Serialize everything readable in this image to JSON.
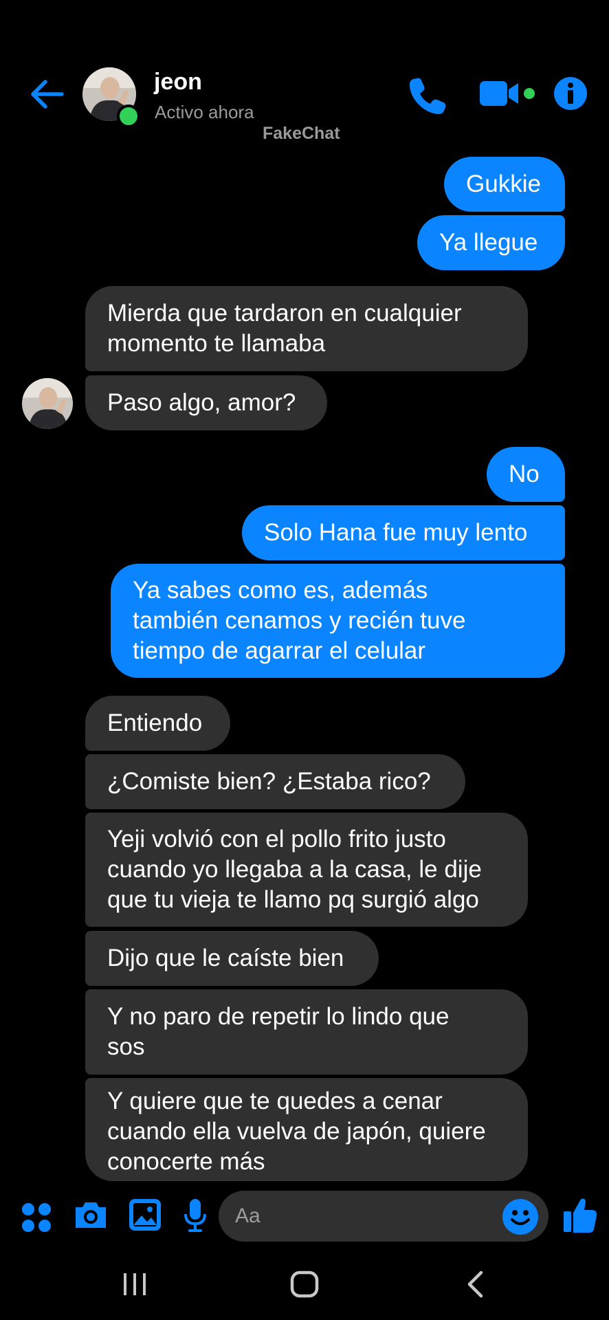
{
  "header": {
    "contact_name": "jeon",
    "status": "Activo ahora",
    "watermark": "FakeChat"
  },
  "messages": [
    {
      "from": "me",
      "text": "Gukkie"
    },
    {
      "from": "me",
      "text": "Ya llegue"
    },
    {
      "from": "them",
      "lines": [
        "Mierda que tardaron en cualquier",
        "momento te llamaba"
      ]
    },
    {
      "from": "them",
      "text": "Paso algo, amor?"
    },
    {
      "from": "me",
      "text": "No"
    },
    {
      "from": "me",
      "text": "Solo Hana fue muy lento"
    },
    {
      "from": "me",
      "lines": [
        "Ya sabes como es, además",
        "también cenamos y recién tuve",
        "tiempo de agarrar el celular"
      ]
    },
    {
      "from": "them",
      "text": "Entiendo"
    },
    {
      "from": "them",
      "text": "¿Comiste bien? ¿Estaba rico?"
    },
    {
      "from": "them",
      "lines": [
        "Yeji volvió con el pollo frito justo",
        "cuando yo llegaba a la casa, le dije",
        "que tu vieja te llamo pq surgió algo"
      ]
    },
    {
      "from": "them",
      "text": "Dijo que le caíste bien"
    },
    {
      "from": "them",
      "lines": [
        "Y no paro de repetir lo lindo que",
        "sos"
      ]
    },
    {
      "from": "them",
      "lines": [
        "Y quiere que te quedes a cenar",
        "cuando ella vuelva de japón, quiere",
        "conocerte más"
      ]
    }
  ],
  "composer": {
    "placeholder": "Aa"
  },
  "icons": {
    "back": "arrow-left-icon",
    "call": "phone-icon",
    "video": "video-camera-icon",
    "info": "info-icon",
    "menu": "four-dots-icon",
    "camera": "camera-icon",
    "gallery": "image-icon",
    "mic": "microphone-icon",
    "emoji": "smiley-icon",
    "like": "thumbs-up-icon"
  },
  "colors": {
    "accent": "#0a84ff",
    "sent_bubble": "#0a84ff",
    "received_bubble": "#303030",
    "online": "#31d158",
    "background": "#000000"
  }
}
